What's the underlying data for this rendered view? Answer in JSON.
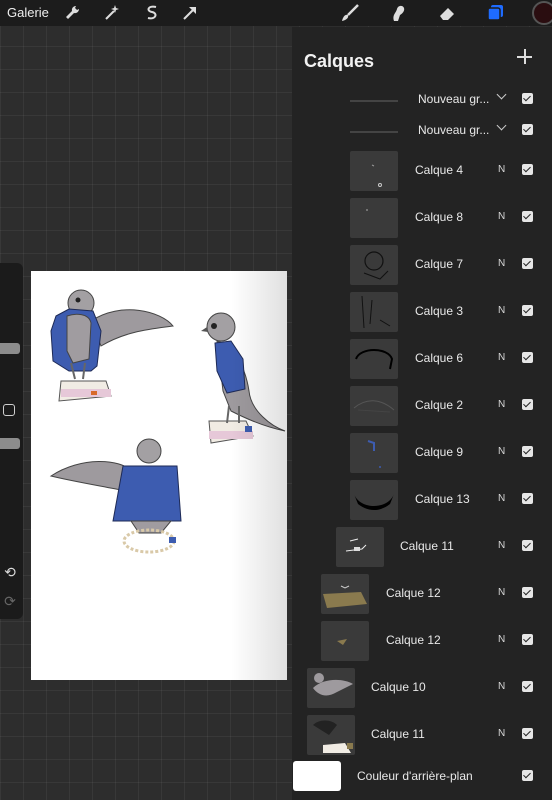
{
  "topbar": {
    "gallery_label": "Galerie",
    "tools": [
      "wrench-icon",
      "magic-wand-icon",
      "selection-icon",
      "transform-arrow-icon",
      "brush-icon",
      "smudge-icon",
      "eraser-icon",
      "layers-icon"
    ],
    "color_swatch": "#2a0d10",
    "accent_color": "#1e6bff"
  },
  "layers_panel": {
    "title": "Calques",
    "add_icon": "plus-icon",
    "groups": [
      {
        "label": "Nouveau gr...",
        "visible": true
      },
      {
        "label": "Nouveau gr...",
        "visible": true
      }
    ],
    "layers": [
      {
        "label": "Calque 4",
        "blend": "N",
        "visible": true
      },
      {
        "label": "Calque 8",
        "blend": "N",
        "visible": true
      },
      {
        "label": "Calque 7",
        "blend": "N",
        "visible": true
      },
      {
        "label": "Calque 3",
        "blend": "N",
        "visible": true
      },
      {
        "label": "Calque 6",
        "blend": "N",
        "visible": true
      },
      {
        "label": "Calque 2",
        "blend": "N",
        "visible": true
      },
      {
        "label": "Calque 9",
        "blend": "N",
        "visible": true
      },
      {
        "label": "Calque 13",
        "blend": "N",
        "visible": true
      },
      {
        "label": "Calque 11",
        "blend": "N",
        "visible": true
      },
      {
        "label": "Calque 12",
        "blend": "N",
        "visible": true
      },
      {
        "label": "Calque 12",
        "blend": "N",
        "visible": true
      },
      {
        "label": "Calque 10",
        "blend": "N",
        "visible": true
      },
      {
        "label": "Calque 11",
        "blend": "N",
        "visible": true
      }
    ],
    "background": {
      "label": "Couleur d'arrière-plan",
      "visible": true
    }
  }
}
